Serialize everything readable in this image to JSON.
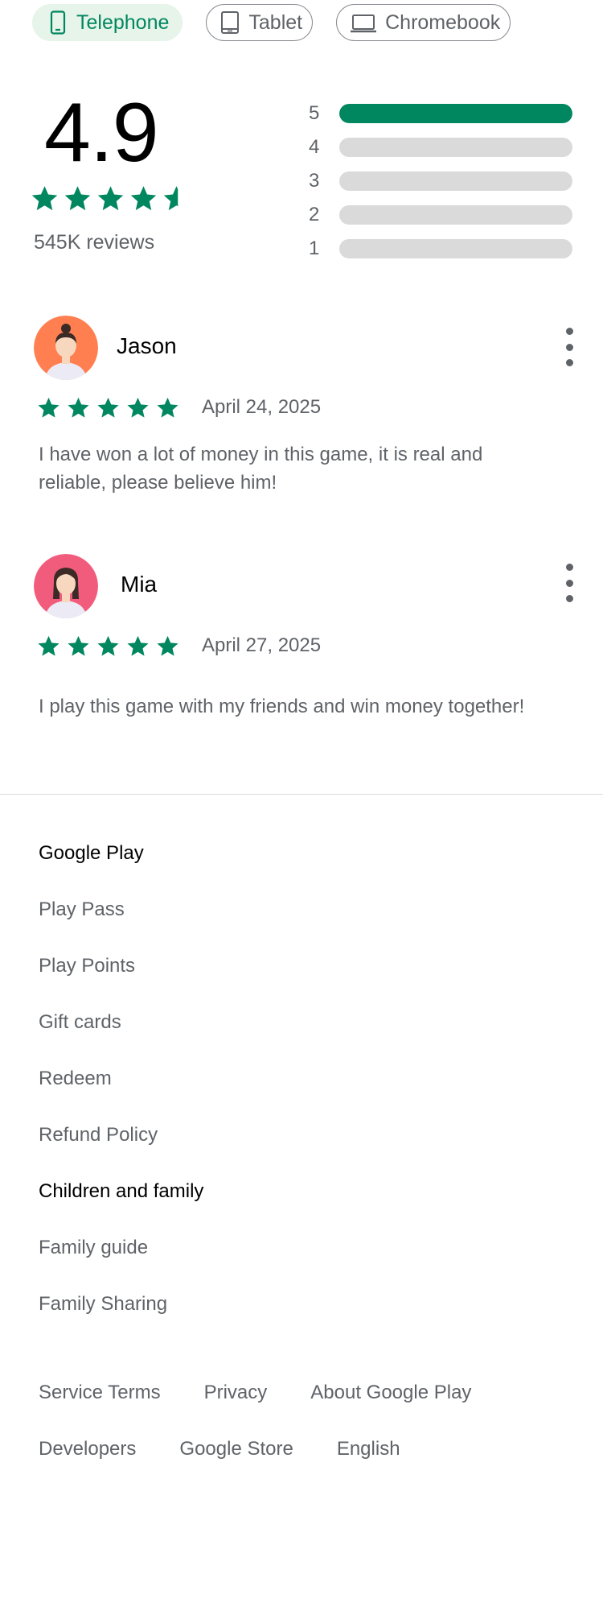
{
  "device_tabs": [
    {
      "label": "Telephone",
      "icon": "phone-icon",
      "active": true
    },
    {
      "label": "Tablet",
      "icon": "tablet-icon",
      "active": false
    },
    {
      "label": "Chromebook",
      "icon": "laptop-icon",
      "active": false
    }
  ],
  "rating": {
    "score": "4.9",
    "stars": 4.9,
    "reviews_count": "545K reviews",
    "distribution": [
      {
        "label": "5",
        "fraction": 1.0
      },
      {
        "label": "4",
        "fraction": 0.0
      },
      {
        "label": "3",
        "fraction": 0.0
      },
      {
        "label": "2",
        "fraction": 0.0
      },
      {
        "label": "1",
        "fraction": 0.0
      }
    ]
  },
  "reviews": [
    {
      "name": "Jason",
      "stars": 5,
      "date": "April 24, 2025",
      "text": "I have won a lot of money in this game, it is real and reliable, please believe him!",
      "avatar_bg": "#ff7f50"
    },
    {
      "name": "Mia",
      "stars": 5,
      "date": "April 27, 2025",
      "text": "I play this game with my friends and win money together!",
      "avatar_bg": "#f25c7c"
    }
  ],
  "footer": {
    "google_play_heading": "Google Play",
    "google_play_links": [
      "Play Pass",
      "Play Points",
      "Gift cards",
      "Redeem",
      "Refund Policy"
    ],
    "family_heading": "Children and family",
    "family_links": [
      "Family guide",
      "Family Sharing"
    ],
    "legal_row1": [
      "Service Terms",
      "Privacy",
      "About Google Play"
    ],
    "legal_row2": [
      "Developers",
      "Google Store",
      "English"
    ]
  },
  "colors": {
    "accent": "#01875f",
    "accent_bg": "#e6f4ea",
    "muted_text": "#5f6368",
    "bar_track": "#dadada"
  }
}
